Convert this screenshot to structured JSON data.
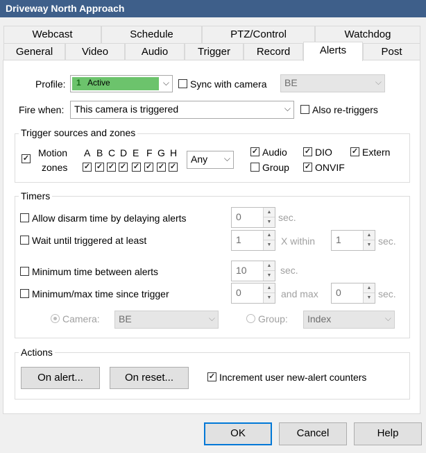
{
  "window": {
    "title": "Driveway North Approach"
  },
  "tabs_row1": [
    "Webcast",
    "Schedule",
    "PTZ/Control",
    "Watchdog"
  ],
  "tabs_row2": [
    "General",
    "Video",
    "Audio",
    "Trigger",
    "Record",
    "Alerts",
    "Post"
  ],
  "active_tab": "Alerts",
  "profile": {
    "label": "Profile:",
    "icon_text": "1",
    "value": "Active",
    "color": "#6cc36c"
  },
  "sync": {
    "label": "Sync with camera",
    "checked": false,
    "value": "BE"
  },
  "fire_when": {
    "label": "Fire when:",
    "value": "This camera is triggered"
  },
  "retriggers": {
    "label": "Also re-triggers",
    "checked": false
  },
  "trigger_sources": {
    "legend": "Trigger sources and zones",
    "motion_label_1": "Motion",
    "motion_label_2": "zones",
    "zones": [
      "A",
      "B",
      "C",
      "D",
      "E",
      "F",
      "G",
      "H"
    ],
    "any": "Any",
    "audio": "Audio",
    "dio": "DIO",
    "extern": "Extern",
    "group": "Group",
    "onvif": "ONVIF"
  },
  "timers": {
    "legend": "Timers",
    "disarm": {
      "label": "Allow disarm time by delaying alerts",
      "value": "0",
      "unit": "sec."
    },
    "wait": {
      "label": "Wait until triggered at least",
      "value": "1",
      "within_label": "X within",
      "within_value": "1",
      "unit": "sec."
    },
    "min_between": {
      "label": "Minimum time between alerts",
      "value": "10",
      "unit": "sec."
    },
    "minmax": {
      "label": "Minimum/max time since trigger",
      "value": "0",
      "max_label": "and max",
      "max_value": "0",
      "unit": "sec."
    },
    "camera_label": "Camera:",
    "camera_value": "BE",
    "group_label": "Group:",
    "group_value": "Index"
  },
  "actions": {
    "legend": "Actions",
    "on_alert": "On alert...",
    "on_reset": "On reset...",
    "increment": "Increment user new-alert counters"
  },
  "footer": {
    "ok": "OK",
    "cancel": "Cancel",
    "help": "Help"
  }
}
